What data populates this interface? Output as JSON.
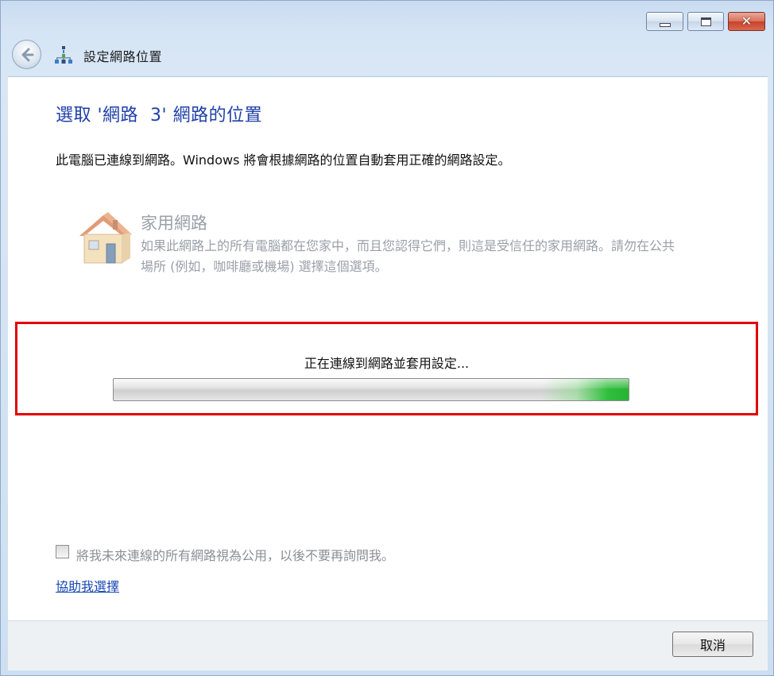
{
  "window": {
    "title": "設定網路位置",
    "controls": {
      "minimize_icon": "minimize-icon",
      "maximize_icon": "maximize-icon",
      "close_icon": "close-icon",
      "close_glyph": "✕"
    }
  },
  "nav": {
    "back_icon": "back-arrow-icon",
    "network_icon": "network-icon"
  },
  "main": {
    "heading": "選取 '網路  3' 網路的位置",
    "intro": "此電腦已連線到網路。Windows 將會根據網路的位置自動套用正確的網路設定。",
    "option": {
      "icon": "home-icon",
      "title": "家用網路",
      "description": "如果此網路上的所有電腦都在您家中，而且您認得它們，則這是受信任的家用網路。請勿在公共場所 (例如，咖啡廳或機場) 選擇這個選項。"
    },
    "status": {
      "text": "正在連線到網路並套用設定...",
      "progress_note": "indeterminate progress, green highlight near right end"
    },
    "opt_out": {
      "checked": false,
      "label": "將我未來連線的所有網路視為公用，以後不要再詢問我。"
    },
    "help_link": "協助我選擇"
  },
  "footer": {
    "cancel_label": "取消"
  },
  "colors": {
    "heading": "#1f3fa8",
    "link": "#1a47b5",
    "highlight_border": "#e30000",
    "progress_green": "#2fbf3c",
    "frame": "#d6e5f5"
  }
}
